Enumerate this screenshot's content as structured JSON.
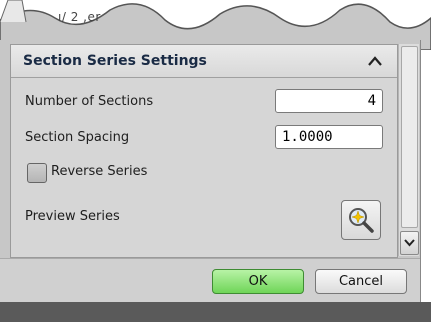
{
  "window": {
    "tab_fragment": "ı/ 2 ,er"
  },
  "panel": {
    "title": "Section Series Settings",
    "collapse_icon": "chevron-up-icon"
  },
  "fields": {
    "number_of_sections": {
      "label": "Number of Sections",
      "value": "4"
    },
    "section_spacing": {
      "label": "Section Spacing",
      "value": "1.0000"
    }
  },
  "reverse_series": {
    "label": "Reverse Series",
    "checked": false
  },
  "preview": {
    "label": "Preview Series",
    "icon": "magnifier-sparkle-icon"
  },
  "scrollbar": {
    "down_icon": "chevron-down-icon"
  },
  "footer": {
    "ok_label": "OK",
    "cancel_label": "Cancel"
  },
  "colors": {
    "ok_button": "#7fdc67",
    "panel_title": "#1a2b45"
  }
}
